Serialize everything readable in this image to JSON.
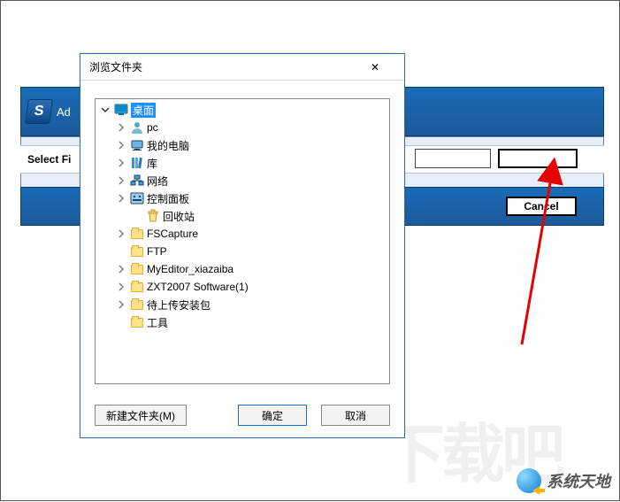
{
  "background": {
    "appTitle": "Ad",
    "selectLabel": "Select Fi",
    "cancelLabel": "Cancel"
  },
  "dialog": {
    "title": "浏览文件夹",
    "newFolderLabel": "新建文件夹(M)",
    "okLabel": "确定",
    "cancelLabel": "取消"
  },
  "tree": [
    {
      "label": "桌面",
      "depth": 0,
      "icon": "desktop",
      "selected": true,
      "expanded": true,
      "hasChildren": true
    },
    {
      "label": "pc",
      "depth": 1,
      "icon": "user",
      "hasChildren": true
    },
    {
      "label": "我的电脑",
      "depth": 1,
      "icon": "computer",
      "hasChildren": true
    },
    {
      "label": "库",
      "depth": 1,
      "icon": "library",
      "hasChildren": true
    },
    {
      "label": "网络",
      "depth": 1,
      "icon": "network",
      "hasChildren": true
    },
    {
      "label": "控制面板",
      "depth": 1,
      "icon": "control-panel",
      "hasChildren": true
    },
    {
      "label": "回收站",
      "depth": 2,
      "icon": "recycle",
      "hasChildren": false
    },
    {
      "label": "FSCapture",
      "depth": 1,
      "icon": "folder",
      "hasChildren": true
    },
    {
      "label": "FTP",
      "depth": 1,
      "icon": "folder",
      "hasChildren": false
    },
    {
      "label": "MyEditor_xiazaiba",
      "depth": 1,
      "icon": "folder",
      "hasChildren": true
    },
    {
      "label": "ZXT2007 Software(1)",
      "depth": 1,
      "icon": "folder",
      "hasChildren": true
    },
    {
      "label": "待上传安装包",
      "depth": 1,
      "icon": "folder",
      "hasChildren": true
    },
    {
      "label": "工具",
      "depth": 1,
      "icon": "folder",
      "hasChildren": false
    }
  ],
  "watermark": {
    "text": "系统天地",
    "bgText": "下载吧"
  }
}
